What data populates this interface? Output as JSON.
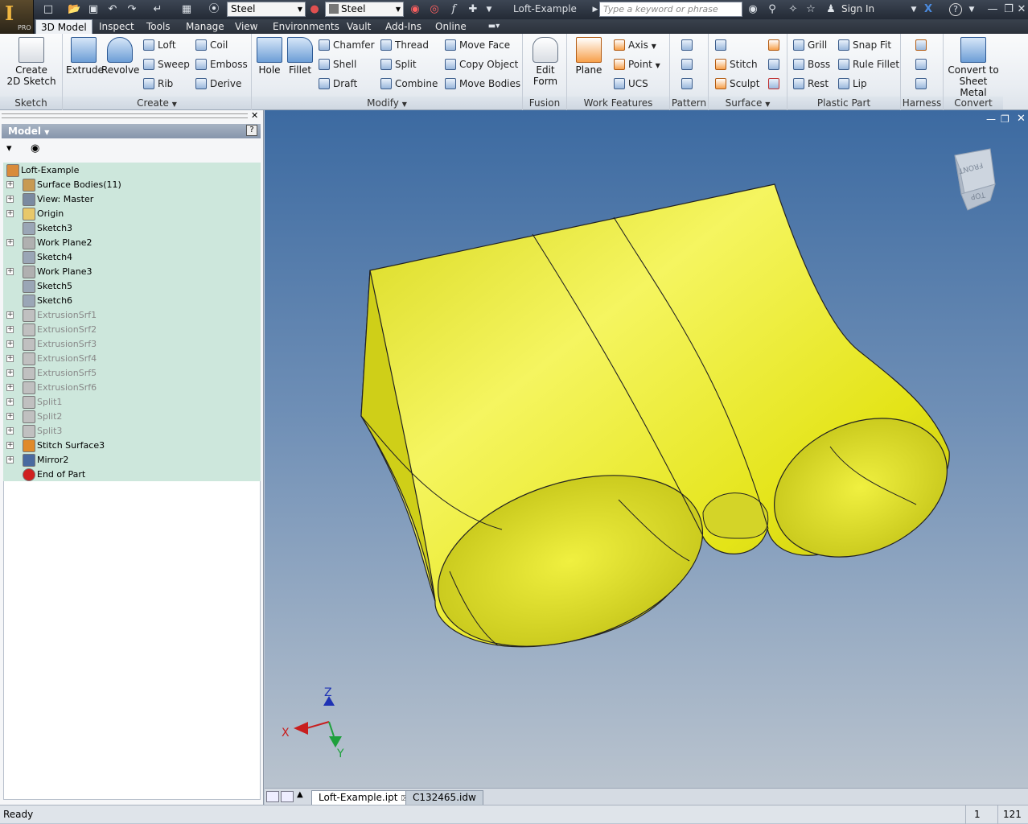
{
  "window": {
    "title": "Loft-Example",
    "material_combo": "Steel",
    "appearance_combo": "Steel",
    "search_placeholder": "Type a keyword or phrase",
    "sign_in": "Sign In",
    "logo_badge": "PRO"
  },
  "tabs": [
    "3D Model",
    "Inspect",
    "Tools",
    "Manage",
    "View",
    "Environments",
    "Vault",
    "Add-Ins",
    "Online"
  ],
  "ribbon": {
    "sketch": {
      "label": "Sketch",
      "create_sketch": "Create\n2D Sketch"
    },
    "create": {
      "label": "Create",
      "extrude": "Extrude",
      "revolve": "Revolve",
      "loft": "Loft",
      "sweep": "Sweep",
      "rib": "Rib",
      "coil": "Coil",
      "emboss": "Emboss",
      "derive": "Derive"
    },
    "modify": {
      "label": "Modify",
      "hole": "Hole",
      "fillet": "Fillet",
      "chamfer": "Chamfer",
      "shell": "Shell",
      "draft": "Draft",
      "thread": "Thread",
      "split": "Split",
      "combine": "Combine",
      "move_face": "Move Face",
      "copy_object": "Copy Object",
      "move_bodies": "Move Bodies"
    },
    "fusion": {
      "label": "Fusion",
      "edit_form": "Edit\nForm"
    },
    "work_features": {
      "label": "Work Features",
      "plane": "Plane",
      "axis": "Axis",
      "point": "Point",
      "ucs": "UCS"
    },
    "pattern": {
      "label": "Pattern"
    },
    "surface": {
      "label": "Surface",
      "stitch": "Stitch",
      "sculpt": "Sculpt"
    },
    "plastic_part": {
      "label": "Plastic Part",
      "grill": "Grill",
      "boss": "Boss",
      "rest": "Rest",
      "snap_fit": "Snap Fit",
      "rule_fillet": "Rule Fillet",
      "lip": "Lip"
    },
    "harness": {
      "label": "Harness"
    },
    "convert": {
      "label": "Convert",
      "sheet_metal": "Convert to\nSheet Metal"
    }
  },
  "browser": {
    "header": "Model",
    "tree": [
      {
        "label": "Loft-Example",
        "expander": false,
        "dim": false,
        "icon": "part-icon"
      },
      {
        "label": "Surface Bodies(11)",
        "expander": true,
        "dim": false,
        "icon": "surface-bodies-icon"
      },
      {
        "label": "View: Master",
        "expander": true,
        "dim": false,
        "icon": "view-icon"
      },
      {
        "label": "Origin",
        "expander": true,
        "dim": false,
        "icon": "folder-icon"
      },
      {
        "label": "Sketch3",
        "expander": false,
        "dim": false,
        "icon": "sketch-icon"
      },
      {
        "label": "Work Plane2",
        "expander": true,
        "dim": false,
        "icon": "workplane-icon"
      },
      {
        "label": "Sketch4",
        "expander": false,
        "dim": false,
        "icon": "sketch-icon"
      },
      {
        "label": "Work Plane3",
        "expander": true,
        "dim": false,
        "icon": "workplane-icon"
      },
      {
        "label": "Sketch5",
        "expander": false,
        "dim": false,
        "icon": "sketch-icon"
      },
      {
        "label": "Sketch6",
        "expander": false,
        "dim": false,
        "icon": "sketch-icon"
      },
      {
        "label": "ExtrusionSrf1",
        "expander": true,
        "dim": true,
        "icon": "extrusion-surface-icon"
      },
      {
        "label": "ExtrusionSrf2",
        "expander": true,
        "dim": true,
        "icon": "extrusion-surface-icon"
      },
      {
        "label": "ExtrusionSrf3",
        "expander": true,
        "dim": true,
        "icon": "extrusion-surface-icon"
      },
      {
        "label": "ExtrusionSrf4",
        "expander": true,
        "dim": true,
        "icon": "extrusion-surface-icon"
      },
      {
        "label": "ExtrusionSrf5",
        "expander": true,
        "dim": true,
        "icon": "extrusion-surface-icon"
      },
      {
        "label": "ExtrusionSrf6",
        "expander": true,
        "dim": true,
        "icon": "extrusion-surface-icon"
      },
      {
        "label": "Split1",
        "expander": true,
        "dim": true,
        "icon": "split-icon"
      },
      {
        "label": "Split2",
        "expander": true,
        "dim": true,
        "icon": "split-icon"
      },
      {
        "label": "Split3",
        "expander": true,
        "dim": true,
        "icon": "split-icon"
      },
      {
        "label": "Stitch Surface3",
        "expander": true,
        "dim": false,
        "icon": "stitch-icon"
      },
      {
        "label": "Mirror2",
        "expander": true,
        "dim": false,
        "icon": "mirror-icon"
      },
      {
        "label": "End of Part",
        "expander": false,
        "dim": false,
        "icon": "end-of-part-icon"
      }
    ]
  },
  "viewport": {
    "viewcube": {
      "front": "FRONT",
      "top": "TOP"
    },
    "triad": {
      "x": "X",
      "y": "Y",
      "z": "Z"
    },
    "colors": {
      "model": "#e8e824",
      "x_axis": "#c81e1e",
      "y_axis": "#1ea03c",
      "z_axis": "#1e32b4",
      "bg_top": "#3c6aa1",
      "bg_bottom": "#b9c3ce"
    }
  },
  "doc_tabs": [
    {
      "label": "Loft-Example.ipt",
      "active": true
    },
    {
      "label": "C132465.idw",
      "active": false
    }
  ],
  "status": {
    "text": "Ready",
    "count1": "1",
    "count2": "121"
  }
}
